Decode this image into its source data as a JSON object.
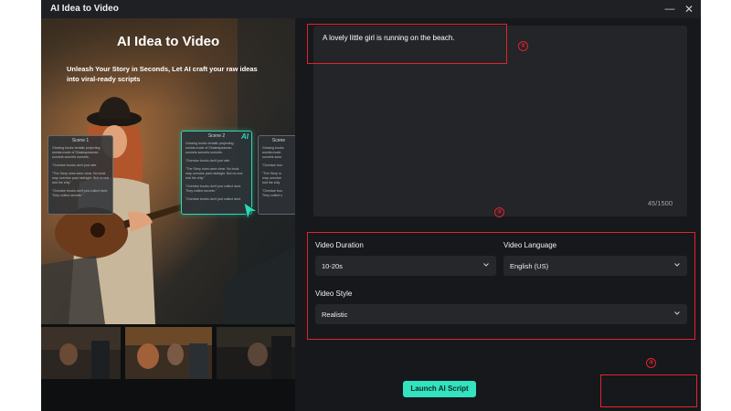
{
  "window": {
    "title": "AI Idea to Video",
    "minimize_icon": "minimize-icon",
    "close_icon": "close-icon"
  },
  "preview": {
    "heading": "AI Idea to Video",
    "subheading": "Unleash Your Story in Seconds, Let AI craft your raw ideas into viral-ready scripts",
    "scene_cards": [
      {
        "title": "Scene 1",
        "lines": [
          "Glowing books tentalic projecting",
          "worlds mode of Shakespearean",
          "sonnets sonnets sonnets.",
          "\"Overdue books don't just rafe.",
          "\"The Story rules were clear. No book",
          "may overdue past midnight. But no one",
          "told the shly.\"",
          "\"Overdue books don't just collect dust.",
          "They collect secrets.\""
        ]
      },
      {
        "title": "Scene 2",
        "badge": "AI",
        "lines": [
          "Glowing books tentalic projecting",
          "worlds mode of Shakespearean",
          "sonnets sonnets sonnets.",
          "\"Overdue books don't just rafe.",
          "\"The Story rules were clear. No book",
          "may overdue past midnight. But no one",
          "told the shly.\"",
          "\"Overdue books don't just collect dust.",
          "They collect secrets.\"",
          "\"Overdue books don't just collect dust."
        ]
      },
      {
        "title": "Scene",
        "lines": [
          "Glowing books",
          "worlds mode",
          "sonnets sonn",
          "\"Overdue boo",
          "\"The Story ru",
          "may overdue",
          "told the shly",
          "\"Overdue boo",
          "They collect s"
        ]
      }
    ],
    "cursor_icon": "cursor-arrow-icon"
  },
  "form": {
    "prompt_text": "A lovely little girl is running on the beach.",
    "char_count": "45/1500",
    "video_duration": {
      "label": "Video Duration",
      "value": "10-20s"
    },
    "video_language": {
      "label": "Video Language",
      "value": "English (US)"
    },
    "video_style": {
      "label": "Video Style",
      "value": "Realistic"
    },
    "chevron_icon": "chevron-down-icon",
    "launch_button": "Launch AI Script"
  },
  "annotations": [
    "①",
    "②",
    "③"
  ],
  "colors": {
    "accent": "#33e2be",
    "annotation": "#e0242a",
    "background": "#16181c",
    "field": "#25272b"
  }
}
